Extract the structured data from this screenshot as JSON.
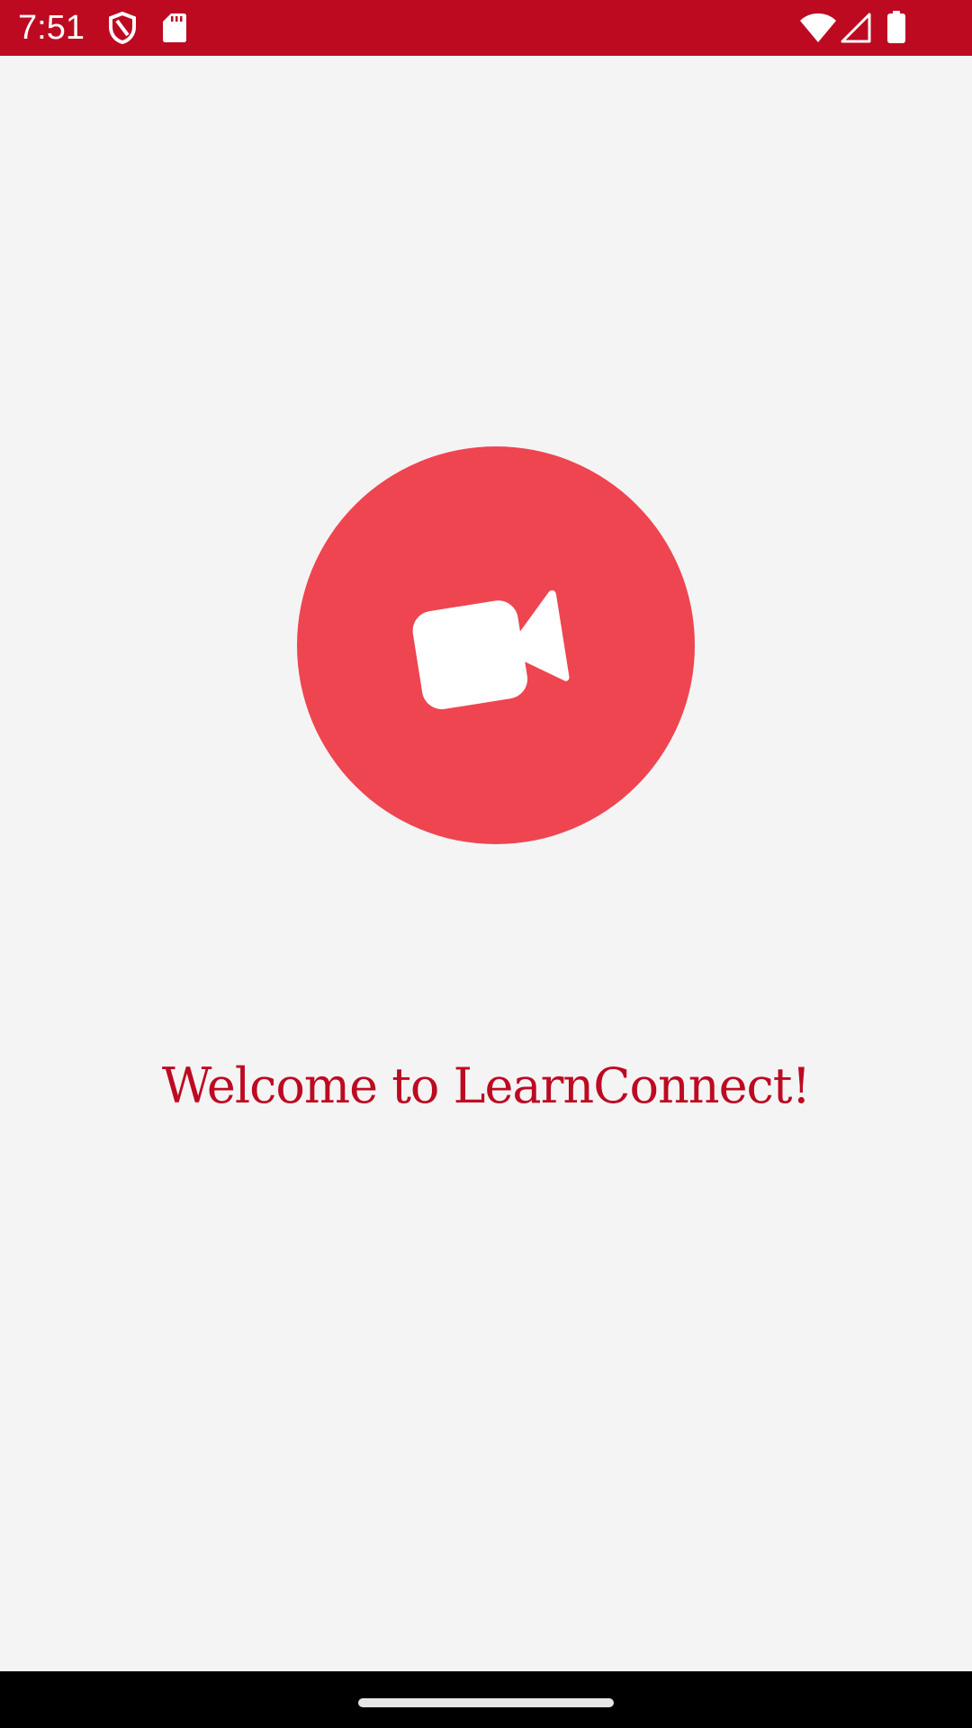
{
  "status_bar": {
    "time": "7:51",
    "background_color": "#bd0a21",
    "left_icons": [
      "shield-icon",
      "sd-card-icon"
    ],
    "right_icons": [
      "wifi-icon",
      "cellular-signal-icon",
      "battery-icon"
    ]
  },
  "main": {
    "logo_icon": "video-camera-icon",
    "logo_color": "#ee4550",
    "welcome_text": "Welcome to LearnConnect!",
    "welcome_color": "#bd0a21"
  },
  "nav_bar": {
    "home_handle": "gesture-home-handle"
  }
}
